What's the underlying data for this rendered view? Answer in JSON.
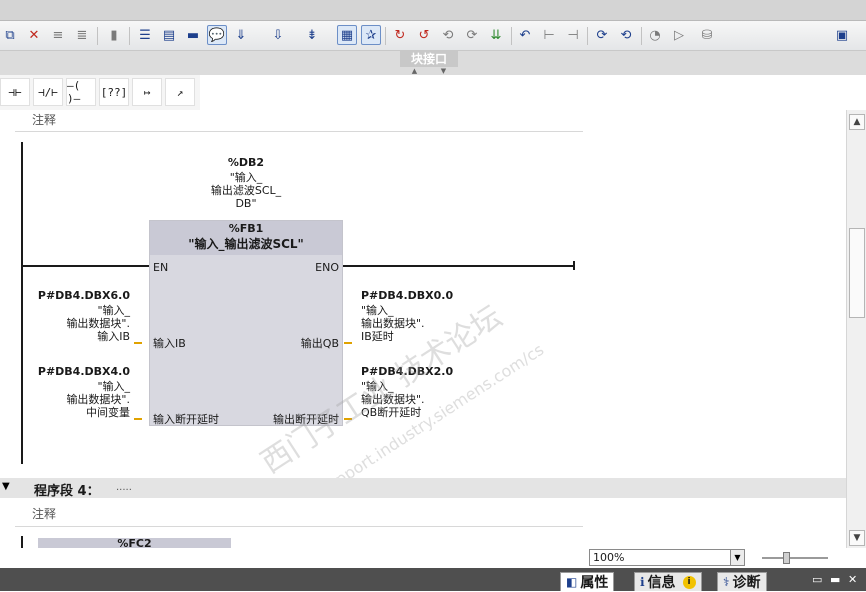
{
  "interface_bar": {
    "label": "块接口"
  },
  "palette": [
    "⊣⊢",
    "⊣/⊢",
    "–( )–",
    "[??]",
    "↦",
    "↗"
  ],
  "segment3": {
    "comment": "注释",
    "db": {
      "address": "%DB2",
      "name_lines": [
        "\"输入_",
        "输出滤波SCL_",
        "DB\""
      ]
    },
    "fb": {
      "address": "%FB1",
      "name": "\"输入_输出滤波SCL\"",
      "en": "EN",
      "eno": "ENO"
    },
    "inputs": [
      {
        "address": "P#DB4.DBX6.0",
        "lines": [
          "\"输入_",
          "输出数据块\".",
          "输入IB"
        ],
        "pin": "输入IB"
      },
      {
        "address": "P#DB4.DBX4.0",
        "lines": [
          "\"输入_",
          "输出数据块\".",
          "中间变量"
        ],
        "pin": "输入断开延时"
      }
    ],
    "outputs": [
      {
        "address": "P#DB4.DBX0.0",
        "lines": [
          "\"输入_",
          "输出数据块\".",
          "IB延时"
        ],
        "pin": "输出QB"
      },
      {
        "address": "P#DB4.DBX2.0",
        "lines": [
          "\"输入_",
          "输出数据块\".",
          "QB断开延时"
        ],
        "pin": "输出断开延时"
      }
    ]
  },
  "segment4": {
    "title": "程序段 4：",
    "title_dots": ".....",
    "comment": "注释",
    "fc_address": "%FC2"
  },
  "zoom": {
    "value": "100%"
  },
  "bottom_tabs": [
    "属性",
    "信息",
    "诊断"
  ],
  "watermark": {
    "line1": "西门子工业  技术论坛",
    "line2": "support.industry.siemens.com/cs"
  },
  "colors": {
    "address_teal": "#14a3a3",
    "fb_body": "#d8d8e0",
    "pin_wire": "#e0a200"
  }
}
